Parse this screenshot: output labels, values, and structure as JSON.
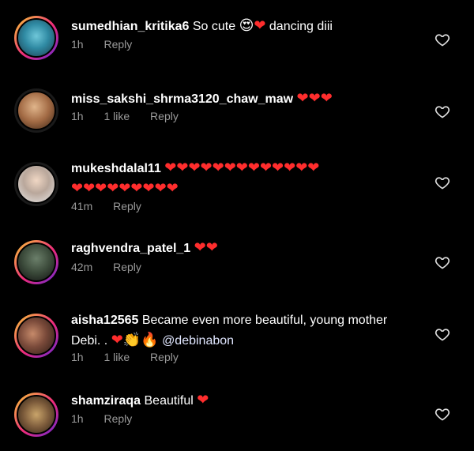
{
  "colors": {
    "background": "#000000",
    "heart_red": "#ff2d2d",
    "meta_gray": "#9a9a9a"
  },
  "comments": [
    {
      "username": "sumedhian_kritika6",
      "text": "So cute",
      "emoji_after": [
        "😍",
        "❤"
      ],
      "text2": "dancing diii",
      "time": "1h",
      "likes": "",
      "reply": "Reply"
    },
    {
      "username": "miss_sakshi_shrma3120_chaw_maw",
      "text": "",
      "hearts": "❤❤❤",
      "time": "1h",
      "likes": "1 like",
      "reply": "Reply"
    },
    {
      "username": "mukeshdalal11",
      "hearts_line1": "❤❤❤❤❤❤❤❤❤❤❤❤❤",
      "hearts_line2": "❤❤❤❤❤❤❤❤❤",
      "time": "41m",
      "likes": "",
      "reply": "Reply"
    },
    {
      "username": "raghvendra_patel_1",
      "hearts": "❤❤",
      "time": "42m",
      "likes": "",
      "reply": "Reply"
    },
    {
      "username": "aisha12565",
      "text": "Became even more beautiful,  young mother",
      "text_line2": "Debi. .",
      "emoji_line2": "❤👏🔥",
      "mention": "@debinabon",
      "time": "1h",
      "likes": "1 like",
      "reply": "Reply"
    },
    {
      "username": "shamziraqa",
      "text": "Beautiful",
      "hearts": "❤",
      "time": "1h",
      "likes": "",
      "reply": "Reply"
    }
  ],
  "icons": {
    "like": "heart-outline-icon"
  }
}
